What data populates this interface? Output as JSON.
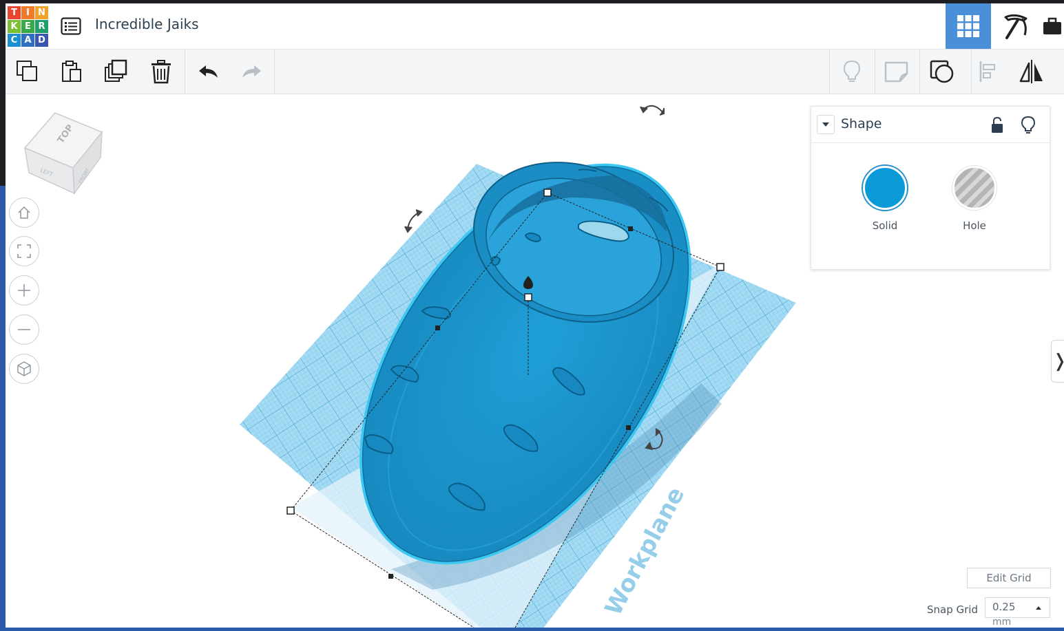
{
  "app": {
    "logo_letters": [
      "T",
      "I",
      "N",
      "K",
      "E",
      "R",
      "C",
      "A",
      "D"
    ],
    "project_title": "Incredible Jaiks"
  },
  "header": {
    "views": [
      {
        "name": "3D Design grid view",
        "icon": "grid-icon",
        "active": true
      },
      {
        "name": "Blocks / build",
        "icon": "pickaxe-icon",
        "active": false
      },
      {
        "name": "Briefcase",
        "icon": "briefcase-icon",
        "active": false
      }
    ]
  },
  "toolbar": {
    "left": [
      "copy-icon",
      "paste-icon",
      "duplicate-icon",
      "trash-icon",
      "undo-icon",
      "redo-icon"
    ],
    "right": [
      "light-bulb-icon",
      "note-icon",
      "shape-window-icon",
      "align-icon",
      "mirror-icon"
    ]
  },
  "viewcube": {
    "top_label": "TOP",
    "left_label": "LEFT",
    "front_label": "FRONT"
  },
  "nav": [
    "home-icon",
    "fit-view-icon",
    "zoom-in-icon",
    "zoom-out-icon",
    "perspective-icon"
  ],
  "shape_panel": {
    "title": "Shape",
    "solid_label": "Solid",
    "hole_label": "Hole",
    "solid_color": "#0a9ad8",
    "selected": "Solid"
  },
  "workplane": {
    "label": "Workplane",
    "color": "#8fd0ee"
  },
  "grid_controls": {
    "edit_label": "Edit Grid",
    "snap_label": "Snap Grid",
    "snap_value": "0.25",
    "snap_unit": "mm"
  },
  "colors": {
    "accent": "#4a90d9",
    "shape": "#1f96cc",
    "outline": "#2cc3f0"
  }
}
